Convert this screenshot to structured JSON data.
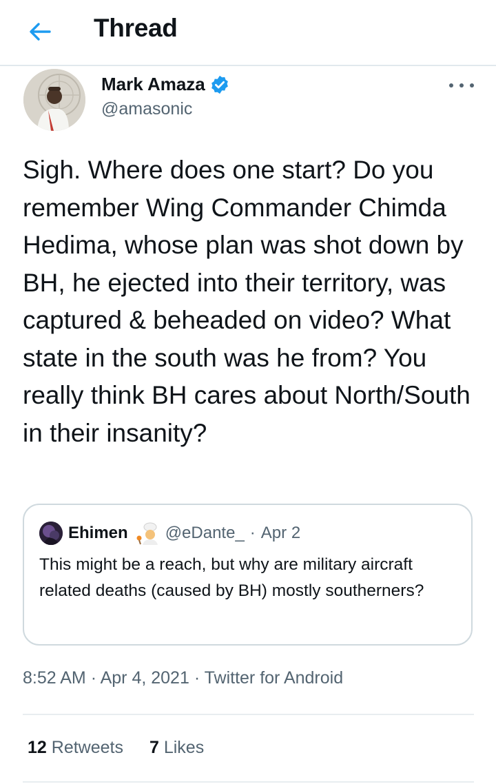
{
  "header": {
    "title": "Thread",
    "back_icon": "arrow-left-icon",
    "accent_color": "#1d9bf0"
  },
  "tweet": {
    "author": {
      "display_name": "Mark Amaza",
      "handle": "@amasonic",
      "verified": true,
      "verified_icon": "verified-badge-icon",
      "verified_color": "#1d9bf0"
    },
    "more_icon": "more-horizontal-icon",
    "text": "Sigh. Where does one start? Do you remember Wing Commander Chimda Hedima, whose plan was shot down by BH, he ejected into their territory, was captured & beheaded on video? What state in the south was he from? You really think BH cares about North/South in their insanity?",
    "quoted": {
      "name": "Ehimen",
      "handle": "@eDante_",
      "separator": "·",
      "date": "Apr 2",
      "name_emoji_icon": "cook-emoji-icon",
      "text": "This might be a reach, but why are military aircraft related deaths (caused by BH) mostly southerners?"
    },
    "time": "8:52 AM",
    "date": "Apr 4, 2021",
    "separator": "·",
    "source": "Twitter for Android",
    "stats": {
      "retweets_count": "12",
      "retweets_label": "Retweets",
      "likes_count": "7",
      "likes_label": "Likes"
    }
  }
}
